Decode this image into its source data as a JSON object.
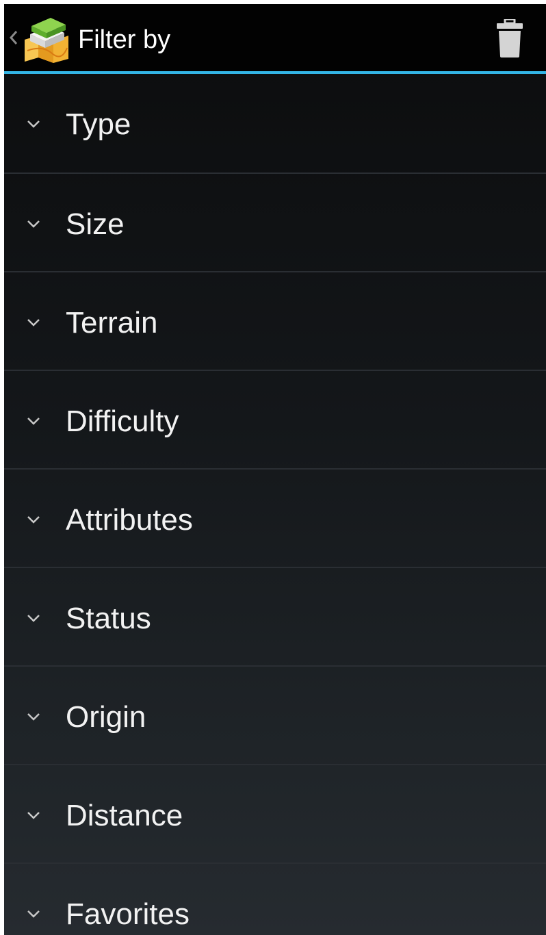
{
  "actionbar": {
    "title": "Filter by",
    "app_icon": "map-app-icon",
    "up_icon": "chevron-left-icon",
    "action_icon": "trash-icon",
    "accent_color": "#33b5e5"
  },
  "filters": {
    "expand_icon": "chevron-down-icon",
    "items": [
      {
        "label": "Type"
      },
      {
        "label": "Size"
      },
      {
        "label": "Terrain"
      },
      {
        "label": "Difficulty"
      },
      {
        "label": "Attributes"
      },
      {
        "label": "Status"
      },
      {
        "label": "Origin"
      },
      {
        "label": "Distance"
      },
      {
        "label": "Favorites"
      }
    ]
  }
}
